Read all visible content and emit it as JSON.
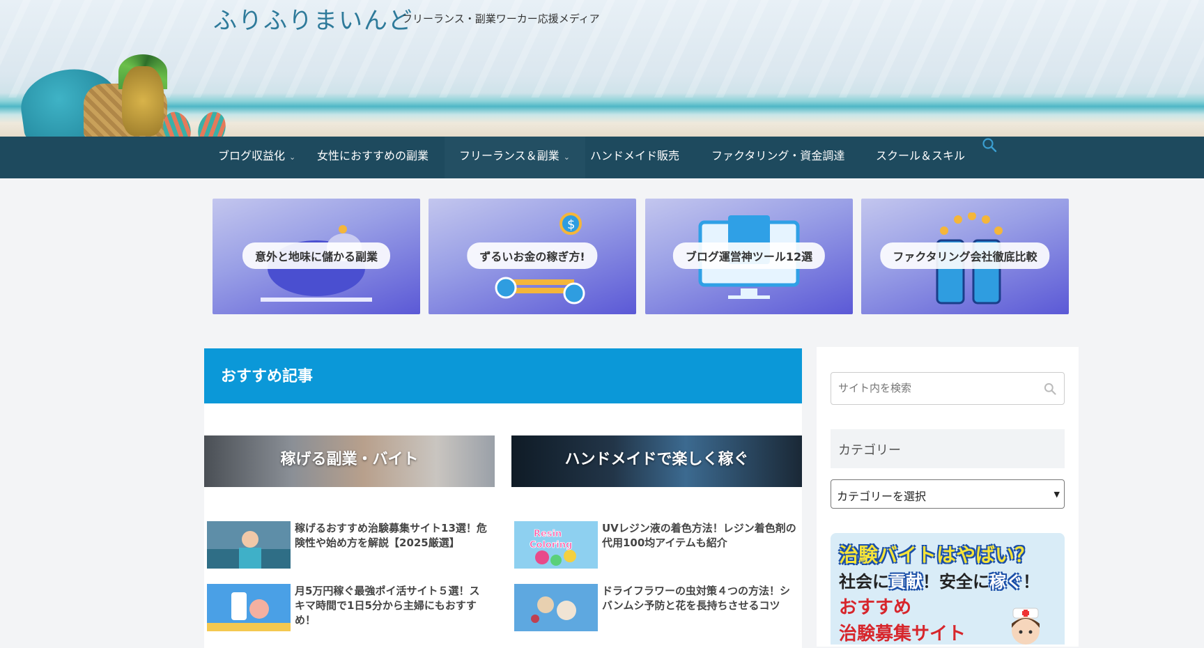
{
  "site": {
    "title": "ふりふりまいんど",
    "tagline": "フリーランス・副業ワーカー応援メディア"
  },
  "nav": {
    "items": [
      {
        "label": "ブログ収益化",
        "has_dropdown": true
      },
      {
        "label": "女性におすすめの副業",
        "has_dropdown": false
      },
      {
        "label": "フリーランス＆副業",
        "has_dropdown": true
      },
      {
        "label": "ハンドメイド販売",
        "has_dropdown": false
      },
      {
        "label": "ファクタリング・資金調達",
        "has_dropdown": false
      },
      {
        "label": "スクール＆スキル",
        "has_dropdown": false
      }
    ],
    "search_icon": "search-icon",
    "accent": "#1e4a5e"
  },
  "banners": [
    {
      "label": "意外と地味に儲かる副業"
    },
    {
      "label": "ずるいお金の稼ぎ方!"
    },
    {
      "label": "ブログ運営神ツール12選"
    },
    {
      "label": "ファクタリング会社徹底比較"
    }
  ],
  "recommended": {
    "heading": "おすすめ記事",
    "accent": "#0b98d8",
    "categories": [
      {
        "label": "稼げる副業・バイト"
      },
      {
        "label": "ハンドメイドで楽しく稼ぐ"
      }
    ],
    "articles_left": [
      {
        "title": "稼げるおすすめ治験募集サイト13選！危険性や始め方を解説【2025厳選】"
      },
      {
        "title": "月5万円稼ぐ最強ポイ活サイト５選！スキマ時間で1日5分から主婦にもおすすめ！"
      }
    ],
    "articles_right": [
      {
        "title": "UVレジン液の着色方法！レジン着色剤の代用100均アイテムも紹介",
        "thumb_text_1": "Resin",
        "thumb_text_2": "Coloring"
      },
      {
        "title": "ドライフラワーの虫対策４つの方法！シバンムシ予防と花を長持ちさせるコツ"
      }
    ]
  },
  "sidebar": {
    "search_placeholder": "サイト内を検索",
    "category_heading": "カテゴリー",
    "category_select": "カテゴリーを選択",
    "ad": {
      "line1": "治験バイトはやばい？",
      "line2_a": "社会に",
      "line2_b": "貢献",
      "line2_c": "！安全に",
      "line2_d": "稼ぐ",
      "line2_e": "！",
      "line3": "おすすめ",
      "line4": "治験募集サイト"
    }
  }
}
